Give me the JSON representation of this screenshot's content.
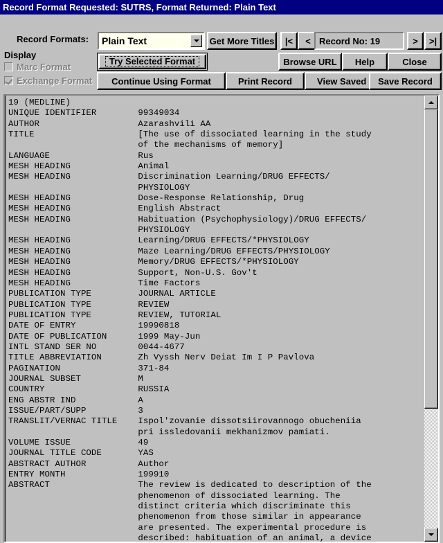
{
  "titlebar": {
    "text": "Record Format Requested: SUTRS, Format Returned: Plain Text"
  },
  "toolbar": {
    "record_formats_label": "Record Formats:",
    "format_combo": {
      "value": "Plain Text",
      "options": [
        "Plain Text"
      ],
      "arrow_icon": "chevron-down-icon"
    },
    "get_more_titles": "Get More Titles",
    "nav": {
      "first": "|<",
      "prev": "<",
      "record_no": "Record No: 19",
      "next": ">",
      "last": ">|"
    },
    "display_group_label": "Display",
    "checkboxes": [
      {
        "label": "Marc Format",
        "checked": false,
        "disabled": true
      },
      {
        "label": "Exchange Format",
        "checked": true,
        "disabled": true
      }
    ],
    "try_selected_format": "Try Selected Format",
    "browse_url": "Browse URL",
    "help": "Help",
    "close": "Close",
    "continue_using_format": "Continue Using Format",
    "print_record": "Print Record",
    "view_saved_records": "View Saved Records",
    "save_record": "Save Record"
  },
  "record": {
    "text": "19 (MEDLINE)\nUNIQUE IDENTIFIER        99349034\nAUTHOR                   Azarashvili AA\nTITLE                    [The use of dissociated learning in the study\n                         of the mechanisms of memory]\nLANGUAGE                 Rus\nMESH HEADING             Animal\nMESH HEADING             Discrimination Learning/DRUG EFFECTS/\n                         PHYSIOLOGY\nMESH HEADING             Dose-Response Relationship, Drug\nMESH HEADING             English Abstract\nMESH HEADING             Habituation (Psychophysiology)/DRUG EFFECTS/\n                         PHYSIOLOGY\nMESH HEADING             Learning/DRUG EFFECTS/*PHYSIOLOGY\nMESH HEADING             Maze Learning/DRUG EFFECTS/PHYSIOLOGY\nMESH HEADING             Memory/DRUG EFFECTS/*PHYSIOLOGY\nMESH HEADING             Support, Non-U.S. Gov't\nMESH HEADING             Time Factors\nPUBLICATION TYPE         JOURNAL ARTICLE\nPUBLICATION TYPE         REVIEW\nPUBLICATION TYPE         REVIEW, TUTORIAL\nDATE OF ENTRY            19990818\nDATE OF PUBLICATION      1999 May-Jun\nINTL STAND SER NO        0044-4677\nTITLE ABBREVIATION       Zh Vyssh Nerv Deiat Im I P Pavlova\nPAGINATION               371-84\nJOURNAL SUBSET           M\nCOUNTRY                  RUSSIA\nENG ABSTR IND            A\nISSUE/PART/SUPP          3\nTRANSLIT/VERNAC TITLE    Ispol'zovanie dissotsiirovannogo obucheniia\n                         pri issledovanii mekhanizmov pamiati.\nVOLUME ISSUE             49\nJOURNAL TITLE CODE       YAS\nABSTRACT AUTHOR          Author\nENTRY MONTH              199910\nABSTRACT                 The review is dedicated to description of the\n                         phenomenon of dissociated learning. The\n                         distinct criteria which discriminate this\n                         phenomenon from those similar in appearance\n                         are presented. The experimental procedure is\n                         described: habituation of an animal, a device"
  },
  "scrollbar": {
    "up_icon": "scroll-up-arrow-icon",
    "down_icon": "scroll-down-arrow-icon"
  },
  "colors": {
    "titlebar_bg": "#000080",
    "titlebar_fg": "#ffffff",
    "window_bg": "#c0c0c0",
    "field_bg": "#ffffee",
    "disabled_fg": "#808080"
  }
}
